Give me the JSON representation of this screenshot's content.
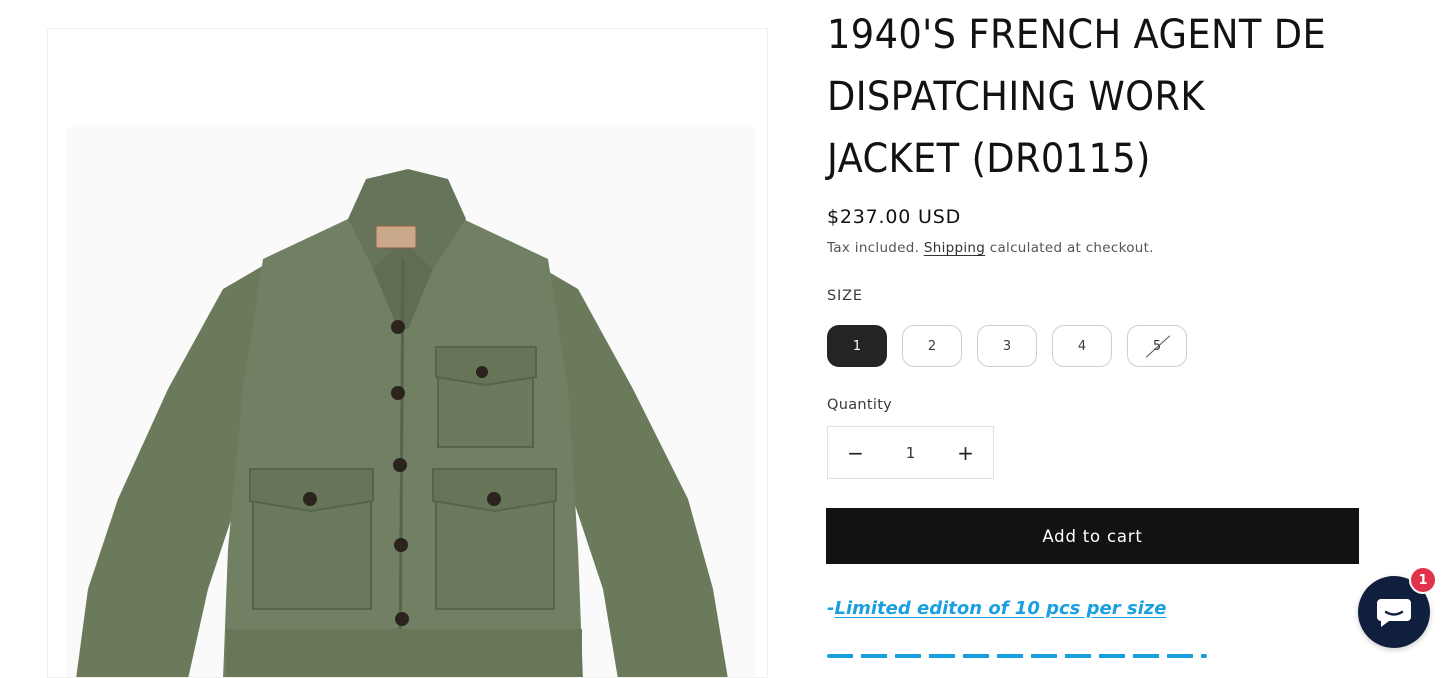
{
  "product": {
    "title": "1940'S FRENCH AGENT DE DISPATCHING WORK JACKET (DR0115)",
    "image_alt": "olive green work jacket",
    "price": "$237.00 USD",
    "tax_prefix": "Tax included.",
    "shipping_link": "Shipping",
    "tax_suffix": "calculated at checkout."
  },
  "size": {
    "label": "SIZE",
    "options": [
      "1",
      "2",
      "3",
      "4",
      "5"
    ],
    "selected": "1",
    "sold_out": [
      "5"
    ]
  },
  "quantity": {
    "label": "Quantity",
    "value": "1",
    "decrease": "−",
    "increase": "+"
  },
  "cart": {
    "add_label": "Add to cart"
  },
  "promo": {
    "dash": "-",
    "line1": "Limited editon of 10 pcs per size"
  },
  "chat": {
    "unread_count": "1",
    "icon": "chat-bubble-icon"
  },
  "colors": {
    "accent_link": "#1a9fe0",
    "cart_button": "#121212",
    "chat_widget": "#0f1f3d",
    "badge": "#e0324b",
    "jacket": "#6f7d60"
  }
}
